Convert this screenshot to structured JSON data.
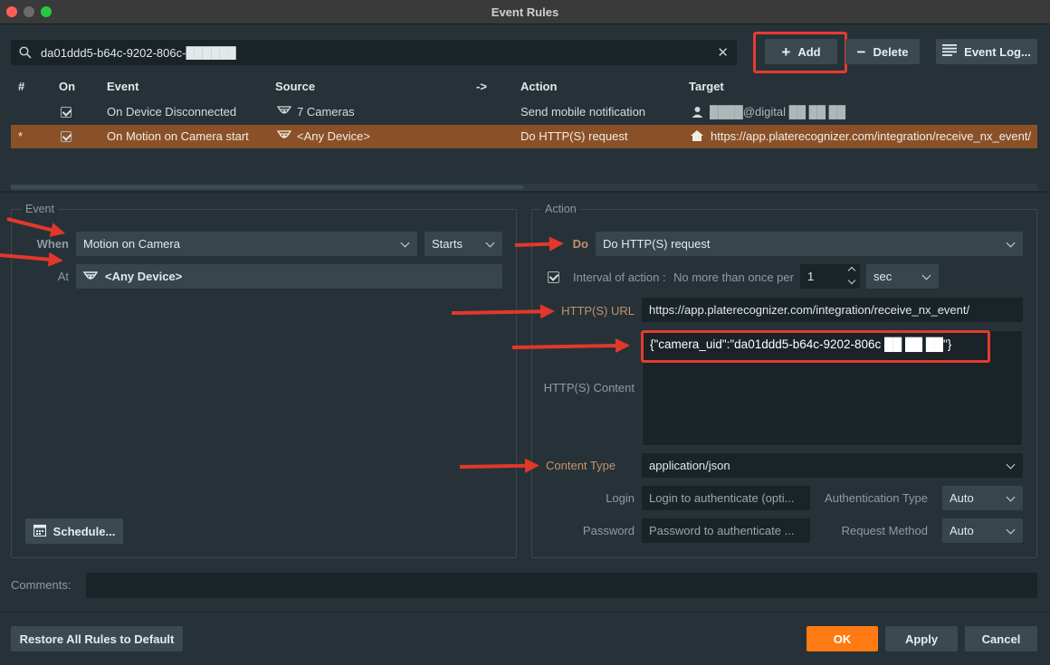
{
  "window": {
    "title": "Event Rules"
  },
  "toolbar": {
    "search_value": "da01ddd5-b64c-9202-806c-██████",
    "add_label": "Add",
    "delete_label": "Delete",
    "event_log_label": "Event Log..."
  },
  "rules_table": {
    "columns": [
      "#",
      "On",
      "Event",
      "Source",
      "->",
      "Action",
      "Target"
    ],
    "rows": [
      {
        "index": "",
        "on": true,
        "event": "On Device Disconnected",
        "source": "7 Cameras",
        "action": "Send mobile notification",
        "target": "████@digital ██ ██ ██",
        "selected": false
      },
      {
        "index": "*",
        "on": true,
        "event": "On Motion on Camera start",
        "source": "<Any Device>",
        "action": "Do HTTP(S) request",
        "target": "https://app.platerecognizer.com/integration/receive_nx_event/",
        "selected": true
      }
    ]
  },
  "event_panel": {
    "title": "Event",
    "when_label": "When",
    "when_value": "Motion on Camera",
    "state_value": "Starts",
    "at_label": "At",
    "at_value": "<Any Device>",
    "schedule_label": "Schedule..."
  },
  "action_panel": {
    "title": "Action",
    "do_label": "Do",
    "do_value": "Do HTTP(S) request",
    "interval_label": "Interval of action :",
    "interval_text": "No more than once per",
    "interval_checked": true,
    "interval_value": "1",
    "interval_unit": "sec",
    "url_label": "HTTP(S) URL",
    "url_value": "https://app.platerecognizer.com/integration/receive_nx_event/",
    "content_label": "HTTP(S) Content",
    "content_value": "{\"camera_uid\":\"da01ddd5-b64c-9202-806c ██ ██ ██\"}",
    "content_type_label": "Content Type",
    "content_type_value": "application/json",
    "login_label": "Login",
    "login_placeholder": "Login to authenticate (opti...",
    "auth_type_label": "Authentication Type",
    "auth_type_value": "Auto",
    "password_label": "Password",
    "password_placeholder": "Password to authenticate ...",
    "request_method_label": "Request Method",
    "request_method_value": "Auto"
  },
  "comments": {
    "label": "Comments:"
  },
  "footer": {
    "restore_label": "Restore All Rules to Default",
    "ok_label": "OK",
    "apply_label": "Apply",
    "cancel_label": "Cancel"
  },
  "colors": {
    "accent_orange": "#ff7a12",
    "highlight_red": "#e53b2e",
    "selected_row": "#8a5128"
  }
}
